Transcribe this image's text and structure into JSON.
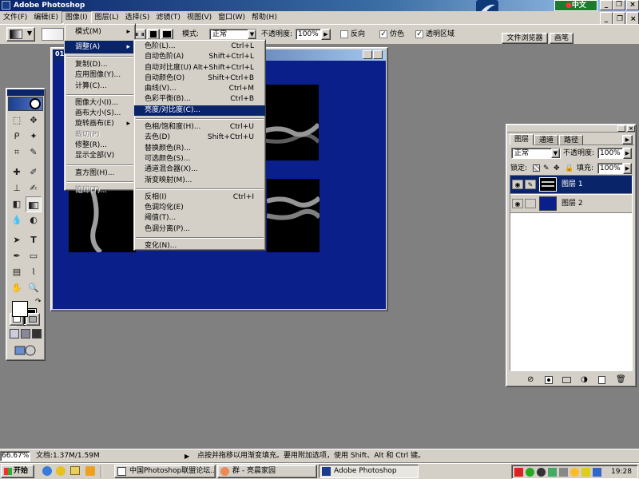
{
  "app": {
    "title": "Adobe Photoshop",
    "ime": "中文"
  },
  "menubar": [
    "文件(F)",
    "编辑(E)",
    "图像(I)",
    "图层(L)",
    "选择(S)",
    "滤镜(T)",
    "视图(V)",
    "窗口(W)",
    "帮助(H)"
  ],
  "options_bar": {
    "mode_label": "模式:",
    "mode_value": "正常",
    "opacity_label": "不透明度:",
    "opacity_value": "100%",
    "reverse_label": "反向",
    "dither_label": "仿色",
    "transparency_label": "透明区域",
    "tab_file_browser": "文件浏览器",
    "tab_brushes": "画笔"
  },
  "image_menu": {
    "items": [
      {
        "label": "模式(M)",
        "submenu": true
      },
      {
        "label": "调整(A)",
        "submenu": true,
        "selected": true
      },
      {
        "sep": true
      },
      {
        "label": "复制(D)..."
      },
      {
        "label": "应用图像(Y)..."
      },
      {
        "label": "计算(C)..."
      },
      {
        "sep": true
      },
      {
        "label": "图像大小(I)..."
      },
      {
        "label": "画布大小(S)..."
      },
      {
        "label": "旋转画布(E)",
        "submenu": true
      },
      {
        "label": "裁切(P)",
        "disabled": true
      },
      {
        "label": "修整(R)..."
      },
      {
        "label": "显示全部(V)"
      },
      {
        "sep": true
      },
      {
        "label": "直方图(H)..."
      },
      {
        "sep": true
      },
      {
        "label": "陷印(T)...",
        "disabled": true
      }
    ]
  },
  "adjust_menu": {
    "items": [
      {
        "label": "色阶(L)...",
        "shortcut": "Ctrl+L"
      },
      {
        "label": "自动色阶(A)",
        "shortcut": "Shift+Ctrl+L"
      },
      {
        "label": "自动对比度(U)",
        "shortcut": "Alt+Shift+Ctrl+L"
      },
      {
        "label": "自动颜色(O)",
        "shortcut": "Shift+Ctrl+B"
      },
      {
        "label": "曲线(V)...",
        "shortcut": "Ctrl+M"
      },
      {
        "label": "色彩平衡(B)...",
        "shortcut": "Ctrl+B"
      },
      {
        "label": "亮度/对比度(C)...",
        "shortcut": "",
        "selected": true
      },
      {
        "sep": true
      },
      {
        "label": "色相/饱和度(H)...",
        "shortcut": "Ctrl+U"
      },
      {
        "label": "去色(D)",
        "shortcut": "Shift+Ctrl+U"
      },
      {
        "label": "替换颜色(R)...",
        "shortcut": ""
      },
      {
        "label": "可选颜色(S)...",
        "shortcut": ""
      },
      {
        "label": "通道混合器(X)...",
        "shortcut": ""
      },
      {
        "label": "渐变映射(M)...",
        "shortcut": ""
      },
      {
        "sep": true
      },
      {
        "label": "反相(I)",
        "shortcut": "Ctrl+I"
      },
      {
        "label": "色调均化(E)",
        "shortcut": ""
      },
      {
        "label": "阈值(T)...",
        "shortcut": ""
      },
      {
        "label": "色调分离(P)...",
        "shortcut": ""
      },
      {
        "sep": true
      },
      {
        "label": "变化(N)...",
        "shortcut": ""
      }
    ]
  },
  "document": {
    "title_stub": "01"
  },
  "layers_panel": {
    "tabs": [
      "图层",
      "通道",
      "路径"
    ],
    "blend_mode": "正常",
    "opacity_label": "不透明度:",
    "opacity_value": "100%",
    "lock_label": "锁定:",
    "fill_label": "填充:",
    "fill_value": "100%",
    "layers": [
      {
        "name": "图层 1",
        "selected": true
      },
      {
        "name": "图层 2",
        "selected": false
      }
    ]
  },
  "statusbar": {
    "zoom": "66.67%",
    "doc_info": "文档:1.37M/1.59M",
    "hint": "点按并拖移以用渐变填充。要用附加选项，使用 Shift、Alt 和 Ctrl 键。"
  },
  "taskbar": {
    "start": "开始",
    "tasks": [
      "中国Photoshop联盟论坛...",
      "群 - 亮晨家园",
      "Adobe Photoshop"
    ],
    "clock": "19:28"
  },
  "colors": {
    "canvas_blue": "#0b1f8a",
    "selection": "#0a246a",
    "chrome": "#d4d0c8"
  }
}
